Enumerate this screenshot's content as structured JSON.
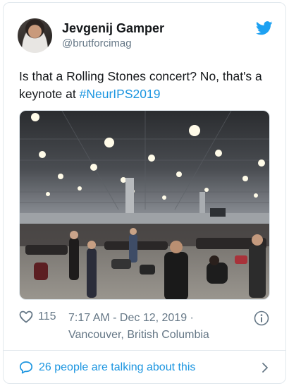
{
  "user": {
    "display_name": "Jevgenij Gamper",
    "handle": "@brutforcimag"
  },
  "tweet": {
    "text_before": "Is that a Rolling Stones concert? No, that's a keynote at ",
    "hashtag": "#NeurIPS2019"
  },
  "meta": {
    "likes": "115",
    "time_line": "7:17 AM - Dec 12, 2019 ·",
    "location": "Vancouver, British Columbia"
  },
  "footer": {
    "talking": "26 people are talking about this"
  },
  "colors": {
    "accent": "#1b95e0",
    "muted": "#657786",
    "text": "#14171a",
    "border": "#e1e8ed"
  },
  "icons": {
    "brand": "twitter-bird-icon",
    "like": "heart-icon",
    "info": "info-icon",
    "reply": "speech-bubble-icon",
    "more": "chevron-right-icon"
  }
}
